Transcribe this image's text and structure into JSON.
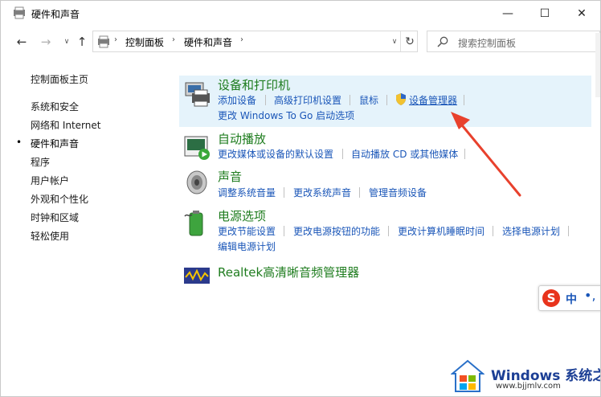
{
  "window": {
    "title": "硬件和声音",
    "minimize_glyph": "—",
    "maximize_glyph": "☐",
    "close_glyph": "✕"
  },
  "nav": {
    "back_glyph": "←",
    "forward_glyph": "→",
    "dropdown_glyph": "∨",
    "up_glyph": "↑",
    "breadcrumbs": [
      "控制面板",
      "硬件和声音"
    ],
    "breadcrumb_sep": "›",
    "refresh_glyph": "↻",
    "search_placeholder": "搜索控制面板"
  },
  "sidebar": {
    "home": "控制面板主页",
    "items": [
      "系统和安全",
      "网络和 Internet",
      "硬件和声音",
      "程序",
      "用户帐户",
      "外观和个性化",
      "时钟和区域",
      "轻松使用"
    ],
    "active_index": 2,
    "bullet": "•"
  },
  "categories": [
    {
      "title": "设备和打印机",
      "icon": "printer-icon",
      "links": [
        "添加设备",
        "高级打印机设置",
        "鼠标",
        "设备管理器"
      ],
      "links2": [
        "更改 Windows To Go 启动选项"
      ]
    },
    {
      "title": "自动播放",
      "icon": "autoplay-icon",
      "links": [
        "更改媒体或设备的默认设置",
        "自动播放 CD 或其他媒体"
      ]
    },
    {
      "title": "声音",
      "icon": "speaker-icon",
      "links": [
        "调整系统音量",
        "更改系统声音",
        "管理音频设备"
      ]
    },
    {
      "title": "电源选项",
      "icon": "battery-icon",
      "links": [
        "更改节能设置",
        "更改电源按钮的功能",
        "更改计算机睡眠时间",
        "选择电源计划"
      ],
      "links2": [
        "编辑电源计划"
      ]
    },
    {
      "title": "Realtek高清晰音频管理器",
      "icon": "realtek-icon",
      "links": []
    }
  ],
  "ime": {
    "logo": "S",
    "mode": "中",
    "punct": "•,"
  },
  "watermark": {
    "title": "Windows 系统之家",
    "url": "www.bjjmlv.com"
  },
  "colors": {
    "link": "#1a56b8",
    "category_title": "#1e7c1e",
    "highlight": "#e5f3fb",
    "arrow": "#e8412d"
  }
}
